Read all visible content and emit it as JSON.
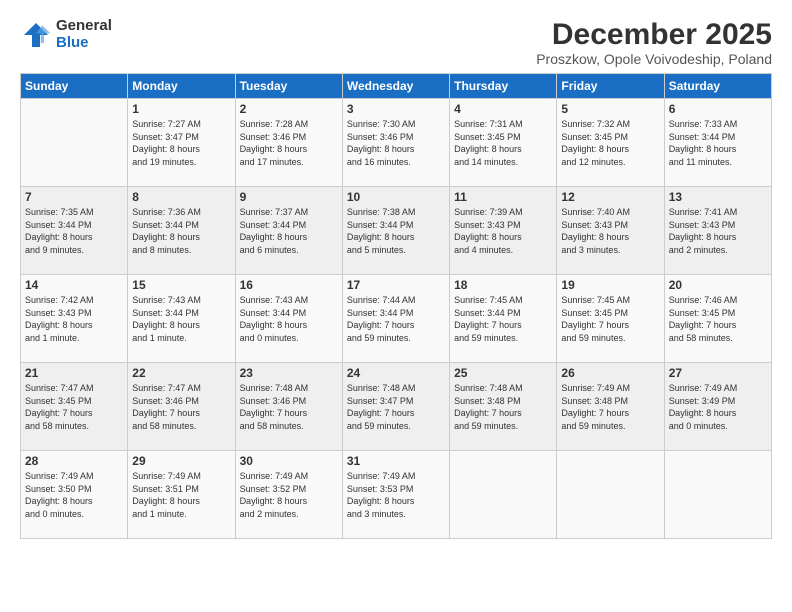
{
  "logo": {
    "general": "General",
    "blue": "Blue"
  },
  "title": "December 2025",
  "subtitle": "Proszkow, Opole Voivodeship, Poland",
  "days_of_week": [
    "Sunday",
    "Monday",
    "Tuesday",
    "Wednesday",
    "Thursday",
    "Friday",
    "Saturday"
  ],
  "weeks": [
    [
      {
        "day": "",
        "info": ""
      },
      {
        "day": "1",
        "info": "Sunrise: 7:27 AM\nSunset: 3:47 PM\nDaylight: 8 hours\nand 19 minutes."
      },
      {
        "day": "2",
        "info": "Sunrise: 7:28 AM\nSunset: 3:46 PM\nDaylight: 8 hours\nand 17 minutes."
      },
      {
        "day": "3",
        "info": "Sunrise: 7:30 AM\nSunset: 3:46 PM\nDaylight: 8 hours\nand 16 minutes."
      },
      {
        "day": "4",
        "info": "Sunrise: 7:31 AM\nSunset: 3:45 PM\nDaylight: 8 hours\nand 14 minutes."
      },
      {
        "day": "5",
        "info": "Sunrise: 7:32 AM\nSunset: 3:45 PM\nDaylight: 8 hours\nand 12 minutes."
      },
      {
        "day": "6",
        "info": "Sunrise: 7:33 AM\nSunset: 3:44 PM\nDaylight: 8 hours\nand 11 minutes."
      }
    ],
    [
      {
        "day": "7",
        "info": "Sunrise: 7:35 AM\nSunset: 3:44 PM\nDaylight: 8 hours\nand 9 minutes."
      },
      {
        "day": "8",
        "info": "Sunrise: 7:36 AM\nSunset: 3:44 PM\nDaylight: 8 hours\nand 8 minutes."
      },
      {
        "day": "9",
        "info": "Sunrise: 7:37 AM\nSunset: 3:44 PM\nDaylight: 8 hours\nand 6 minutes."
      },
      {
        "day": "10",
        "info": "Sunrise: 7:38 AM\nSunset: 3:44 PM\nDaylight: 8 hours\nand 5 minutes."
      },
      {
        "day": "11",
        "info": "Sunrise: 7:39 AM\nSunset: 3:43 PM\nDaylight: 8 hours\nand 4 minutes."
      },
      {
        "day": "12",
        "info": "Sunrise: 7:40 AM\nSunset: 3:43 PM\nDaylight: 8 hours\nand 3 minutes."
      },
      {
        "day": "13",
        "info": "Sunrise: 7:41 AM\nSunset: 3:43 PM\nDaylight: 8 hours\nand 2 minutes."
      }
    ],
    [
      {
        "day": "14",
        "info": "Sunrise: 7:42 AM\nSunset: 3:43 PM\nDaylight: 8 hours\nand 1 minute."
      },
      {
        "day": "15",
        "info": "Sunrise: 7:43 AM\nSunset: 3:44 PM\nDaylight: 8 hours\nand 1 minute."
      },
      {
        "day": "16",
        "info": "Sunrise: 7:43 AM\nSunset: 3:44 PM\nDaylight: 8 hours\nand 0 minutes."
      },
      {
        "day": "17",
        "info": "Sunrise: 7:44 AM\nSunset: 3:44 PM\nDaylight: 7 hours\nand 59 minutes."
      },
      {
        "day": "18",
        "info": "Sunrise: 7:45 AM\nSunset: 3:44 PM\nDaylight: 7 hours\nand 59 minutes."
      },
      {
        "day": "19",
        "info": "Sunrise: 7:45 AM\nSunset: 3:45 PM\nDaylight: 7 hours\nand 59 minutes."
      },
      {
        "day": "20",
        "info": "Sunrise: 7:46 AM\nSunset: 3:45 PM\nDaylight: 7 hours\nand 58 minutes."
      }
    ],
    [
      {
        "day": "21",
        "info": "Sunrise: 7:47 AM\nSunset: 3:45 PM\nDaylight: 7 hours\nand 58 minutes."
      },
      {
        "day": "22",
        "info": "Sunrise: 7:47 AM\nSunset: 3:46 PM\nDaylight: 7 hours\nand 58 minutes."
      },
      {
        "day": "23",
        "info": "Sunrise: 7:48 AM\nSunset: 3:46 PM\nDaylight: 7 hours\nand 58 minutes."
      },
      {
        "day": "24",
        "info": "Sunrise: 7:48 AM\nSunset: 3:47 PM\nDaylight: 7 hours\nand 59 minutes."
      },
      {
        "day": "25",
        "info": "Sunrise: 7:48 AM\nSunset: 3:48 PM\nDaylight: 7 hours\nand 59 minutes."
      },
      {
        "day": "26",
        "info": "Sunrise: 7:49 AM\nSunset: 3:48 PM\nDaylight: 7 hours\nand 59 minutes."
      },
      {
        "day": "27",
        "info": "Sunrise: 7:49 AM\nSunset: 3:49 PM\nDaylight: 8 hours\nand 0 minutes."
      }
    ],
    [
      {
        "day": "28",
        "info": "Sunrise: 7:49 AM\nSunset: 3:50 PM\nDaylight: 8 hours\nand 0 minutes."
      },
      {
        "day": "29",
        "info": "Sunrise: 7:49 AM\nSunset: 3:51 PM\nDaylight: 8 hours\nand 1 minute."
      },
      {
        "day": "30",
        "info": "Sunrise: 7:49 AM\nSunset: 3:52 PM\nDaylight: 8 hours\nand 2 minutes."
      },
      {
        "day": "31",
        "info": "Sunrise: 7:49 AM\nSunset: 3:53 PM\nDaylight: 8 hours\nand 3 minutes."
      },
      {
        "day": "",
        "info": ""
      },
      {
        "day": "",
        "info": ""
      },
      {
        "day": "",
        "info": ""
      }
    ]
  ]
}
